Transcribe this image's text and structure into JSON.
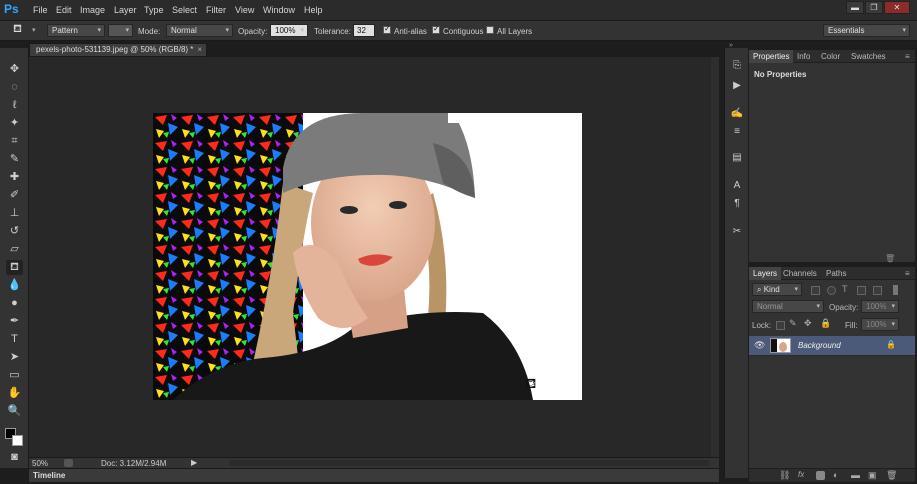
{
  "app": {
    "logo": "Ps"
  },
  "menu": [
    "File",
    "Edit",
    "Image",
    "Layer",
    "Type",
    "Select",
    "Filter",
    "View",
    "Window",
    "Help"
  ],
  "window_controls": {
    "minimize": "▬",
    "restore": "❐",
    "close": "✕"
  },
  "workspace": {
    "value": "Essentials"
  },
  "options": {
    "fill_source": "Pattern",
    "mode_label": "Mode:",
    "mode_value": "Normal",
    "opacity_label": "Opacity:",
    "opacity_value": "100%",
    "tolerance_label": "Tolerance:",
    "tolerance_value": "32",
    "anti_alias": "Anti-alias",
    "contiguous": "Contiguous",
    "all_layers": "All Layers"
  },
  "document": {
    "tab": "pexels-photo-531139.jpeg @ 50% (RGB/8) *",
    "zoom": "50%",
    "doc_size": "Doc: 3.12M/2.94M"
  },
  "timeline": {
    "label": "Timeline"
  },
  "properties": {
    "tabs": [
      "Properties",
      "Info",
      "Color",
      "Swatches"
    ],
    "body": "No Properties"
  },
  "layers": {
    "tabs": [
      "Layers",
      "Channels",
      "Paths"
    ],
    "filter_kind": "Kind",
    "blend": "Normal",
    "opacity_label": "Opacity:",
    "opacity_value": "100%",
    "lock_label": "Lock:",
    "fill_label": "Fill:",
    "fill_value": "100%",
    "items": [
      {
        "name": "Background"
      }
    ]
  },
  "colors": {
    "accent": "#31a8ff",
    "selected_layer": "#4a5a78"
  }
}
